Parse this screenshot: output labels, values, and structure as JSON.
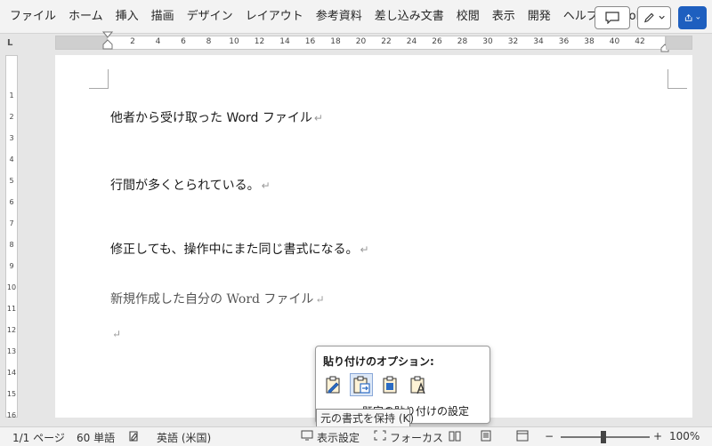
{
  "ribbon": {
    "tabs": [
      "ファイル",
      "ホーム",
      "挿入",
      "描画",
      "デザイン",
      "レイアウト",
      "参考資料",
      "差し込み文書",
      "校閲",
      "表示",
      "開発",
      "ヘルプ",
      "Acrobat"
    ],
    "comment_icon": "comment-icon",
    "editing_icon": "pencil-icon",
    "share_icon": "share-icon"
  },
  "ruler": {
    "corner": "L",
    "numbers": [
      "2",
      "4",
      "6",
      "8",
      "10",
      "12",
      "14",
      "16",
      "18",
      "20",
      "22",
      "24",
      "26",
      "28",
      "30",
      "32",
      "34",
      "36",
      "38",
      "40",
      "42"
    ],
    "vertical_numbers": [
      "1",
      "2",
      "3",
      "4",
      "5",
      "6",
      "7",
      "8",
      "9",
      "10",
      "11",
      "12",
      "13",
      "14",
      "15",
      "16"
    ]
  },
  "document": {
    "paragraphs": [
      {
        "text": "他者から受け取った Word ファイル",
        "style": "sans"
      },
      {
        "text": "行間が多くとられている。",
        "style": "sans"
      },
      {
        "text": "修正しても、操作中にまた同じ書式になる。",
        "style": "sans"
      },
      {
        "text": "新規作成した自分の Word ファイル",
        "style": "serif"
      },
      {
        "text": "",
        "style": "serif"
      }
    ],
    "pilcrow": "↵"
  },
  "paste_options": {
    "title": "貼り付けのオプション:",
    "icons": [
      "keep-source-formatting-icon",
      "merge-formatting-icon",
      "picture-paste-icon",
      "keep-text-only-icon"
    ],
    "selected_index": 1,
    "link_label": "既定の貼り付けの設定(A)...",
    "tooltip": "元の書式を保持 (K)"
  },
  "statusbar": {
    "page": "1/1 ページ",
    "words": "60 単語",
    "language": "英語 (米国)",
    "display_settings": "表示設定",
    "focus": "フォーカス",
    "zoom_minus": "−",
    "zoom_plus": "+",
    "zoom": "100%",
    "zoom_level": 1.0
  }
}
